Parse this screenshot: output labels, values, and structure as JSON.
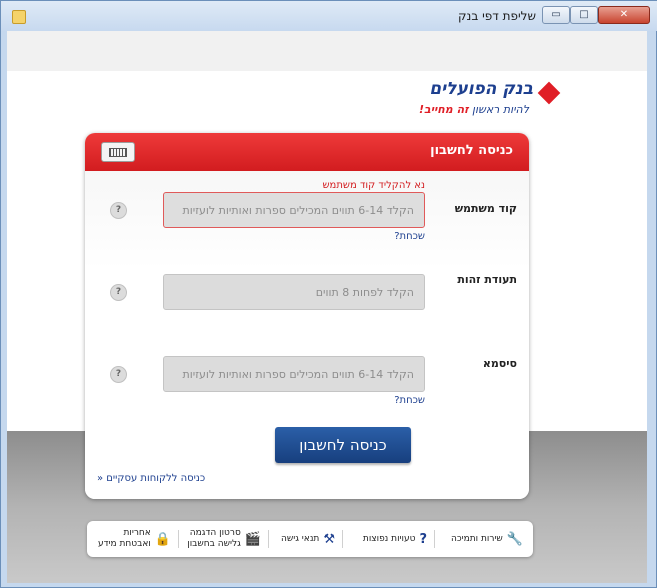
{
  "window": {
    "title": "שליפת דפי בנק",
    "minimize": "▭",
    "maximize": "□",
    "close": "✕"
  },
  "logo": {
    "name": "בנק הפועלים",
    "slogan_start": "להיות ראשון ",
    "slogan_highlight": "זה מחייב!"
  },
  "login": {
    "title": "כניסה לחשבון",
    "fields": [
      {
        "label": "קוד משתמש",
        "placeholder": "הקלד 6-14 תווים המכילים ספרות ואותיות לועזיות",
        "error": "נא להקליד קוד משתמש",
        "forgot": "שכחת?",
        "help": "?"
      },
      {
        "label": "תעודת זהות",
        "placeholder": "הקלד לפחות 8 תווים",
        "help": "?"
      },
      {
        "label": "סיסמא",
        "placeholder": "הקלד 6-14 תווים המכילים ספרות ואותיות לועזיות",
        "forgot": "שכחת?",
        "help": "?"
      }
    ],
    "submit": "כניסה לחשבון",
    "business_link": "כניסה ללקוחות עסקיים «"
  },
  "footer": {
    "items": [
      {
        "label": "שירות ותמיכה",
        "icon": "wrench-icon",
        "glyph": "🔧"
      },
      {
        "label": "טעויות נפוצות",
        "icon": "question-icon",
        "glyph": "?"
      },
      {
        "label": "תנאי גישה",
        "icon": "gavel-icon",
        "glyph": "⚒"
      },
      {
        "label_1": "סרטון הדגמה",
        "label_2": "גלישה בחשבון",
        "icon": "film-icon",
        "glyph": "🎬"
      },
      {
        "label_1": "אחריות",
        "label_2": "ואבטחת מידע",
        "icon": "lock-icon",
        "glyph": "🔒"
      }
    ]
  },
  "colors": {
    "brand_red": "#d21c1f",
    "brand_blue": "#1d3f8f",
    "button_blue": "#1f4f94"
  }
}
